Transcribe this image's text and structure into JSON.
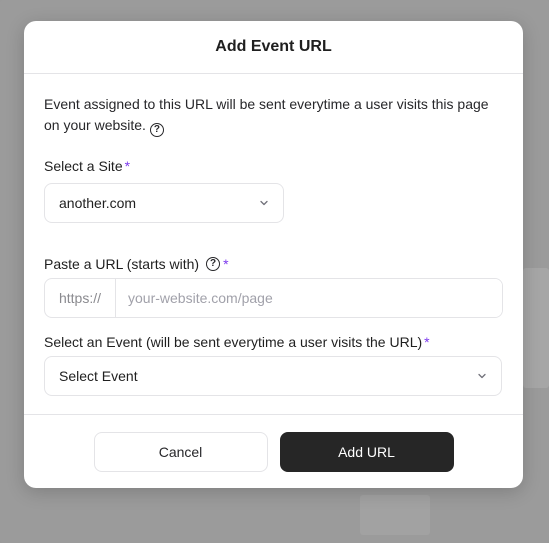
{
  "modal": {
    "title": "Add Event URL",
    "description": "Event assigned to this URL will be sent everytime a user visits this page on your website.",
    "help_icon": "question-circle-icon"
  },
  "site_field": {
    "label": "Select a Site",
    "required_marker": "*",
    "value": "another.com",
    "icon": "chevron-down-icon"
  },
  "url_field": {
    "label": "Paste a URL (starts with)",
    "required_marker": "*",
    "prefix": "https://",
    "placeholder": "your-website.com/page",
    "help_icon": "question-circle-icon"
  },
  "event_field": {
    "label": "Select an Event (will be sent everytime a user visits the URL)",
    "required_marker": "*",
    "value": "Select Event",
    "icon": "chevron-down-icon"
  },
  "footer": {
    "cancel_label": "Cancel",
    "submit_label": "Add URL"
  },
  "colors": {
    "required": "#7c3aed",
    "primary_button": "#262626",
    "border": "#e4e4e7"
  }
}
